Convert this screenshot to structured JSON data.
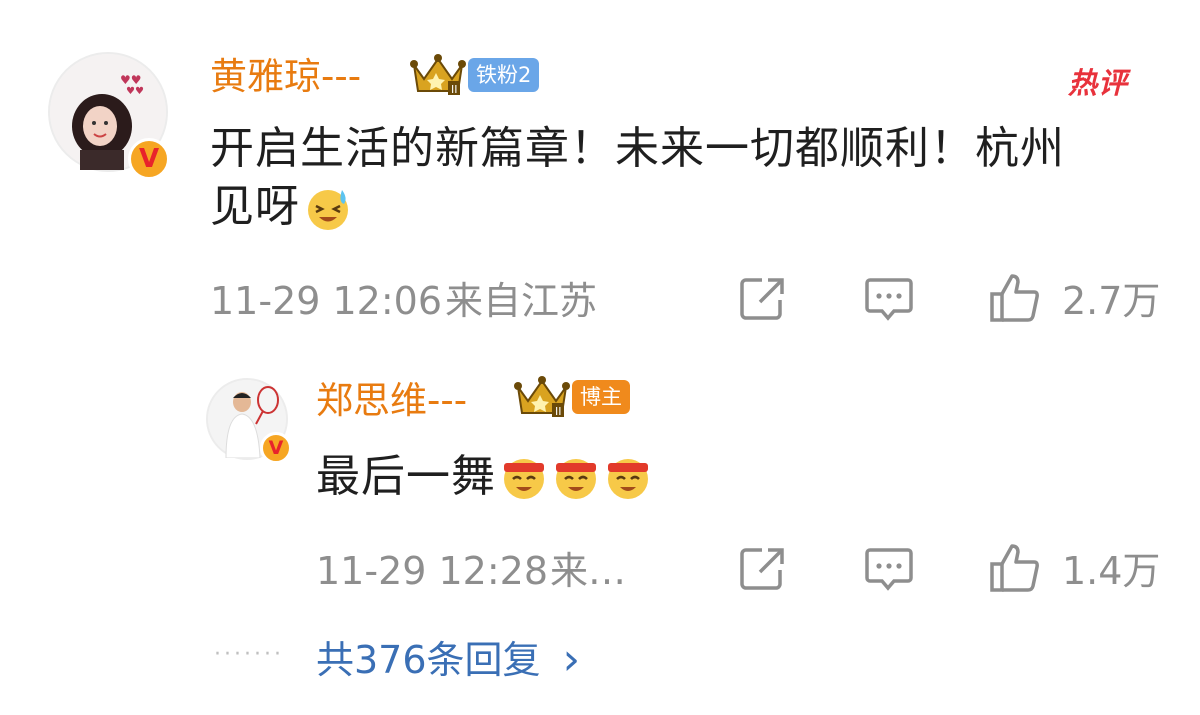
{
  "comments": [
    {
      "username": "黄雅琼---",
      "fan_tag": "铁粉2",
      "hot_label": "热评",
      "text_line1": "开启生活的新篇章！未来一切都顺利！杭州",
      "text_line2": "见呀",
      "emoji": "laughing-with-tears",
      "timestamp": "11-29 12:06",
      "location": "来自江苏",
      "like_count": "2.7万",
      "colors": {
        "username": "#e87b10",
        "fan_tag_bg": "#6aa6e8",
        "hot": "#e8323c"
      }
    },
    {
      "username": "郑思维---",
      "role_tag": "博主",
      "text": "最后一舞",
      "emojis": [
        "cheer-headband",
        "cheer-headband",
        "cheer-headband"
      ],
      "timestamp": "11-29 12:28",
      "location": "来…",
      "like_count": "1.4万",
      "colors": {
        "username": "#e87b10",
        "role_tag_bg": "#f08a1c"
      }
    }
  ],
  "replies_link": {
    "dots": "·······",
    "label": "共376条回复",
    "chevron": "›"
  },
  "icons": [
    "share-icon",
    "comment-icon",
    "like-icon"
  ],
  "colors": {
    "link": "#3a6fb5",
    "meta": "#8e8e8e",
    "text": "#1f1f1f"
  }
}
